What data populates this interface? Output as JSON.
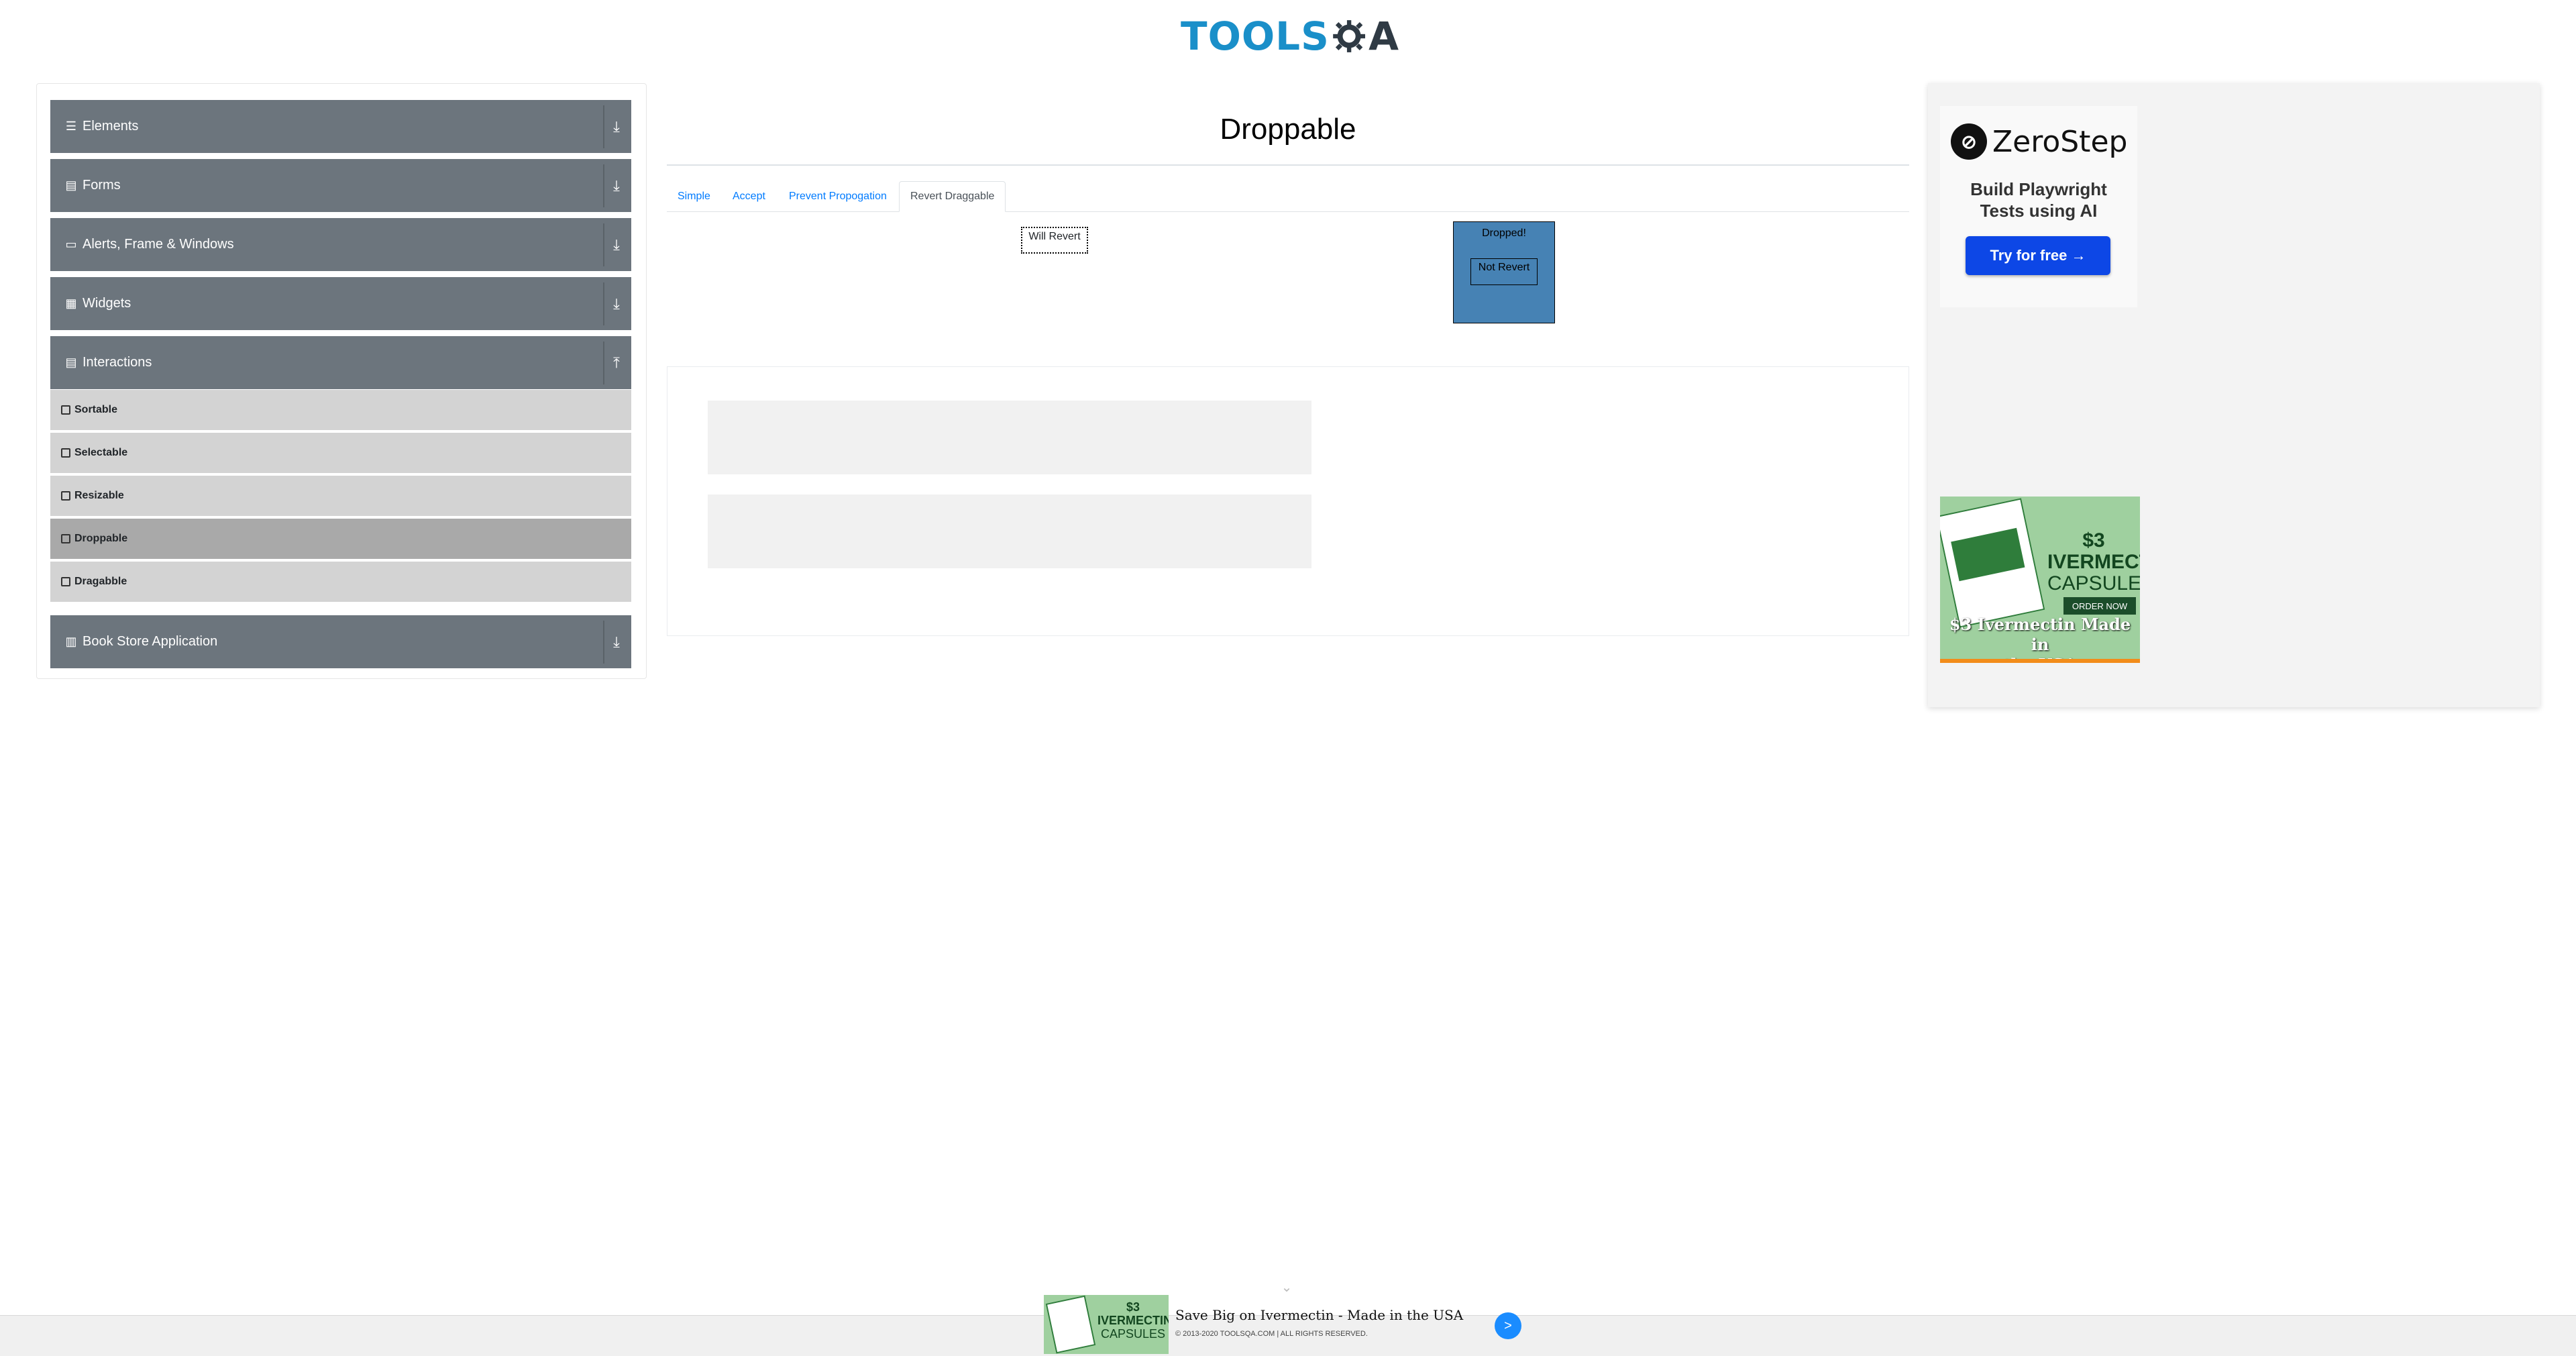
{
  "header": {
    "logo_left": "TOOLS",
    "logo_right": "A"
  },
  "sidebar": {
    "groups": [
      {
        "label": "Elements",
        "icon": "list-icon"
      },
      {
        "label": "Forms",
        "icon": "document-icon"
      },
      {
        "label": "Alerts, Frame & Windows",
        "icon": "window-icon"
      },
      {
        "label": "Widgets",
        "icon": "grid-icon"
      },
      {
        "label": "Interactions",
        "icon": "document-icon",
        "expanded": true
      },
      {
        "label": "Book Store Application",
        "icon": "book-icon"
      }
    ],
    "items": [
      {
        "label": "Sortable"
      },
      {
        "label": "Selectable"
      },
      {
        "label": "Resizable"
      },
      {
        "label": "Droppable",
        "active": true
      },
      {
        "label": "Dragabble"
      }
    ]
  },
  "main": {
    "title": "Droppable",
    "tabs": [
      {
        "label": "Simple"
      },
      {
        "label": "Accept"
      },
      {
        "label": "Prevent Propogation"
      },
      {
        "label": "Revert Draggable",
        "active": true
      }
    ],
    "drag_label": "Will Revert",
    "drop_label": "Dropped!",
    "inner_label": "Not Revert"
  },
  "right_ads": {
    "zerostep_name": "ZeroStep",
    "zerostep_tagline_1": "Build Playwright",
    "zerostep_tagline_2": "Tests using AI",
    "zerostep_button": "Try for free →",
    "iv_price_1": "$3",
    "iv_price_2": "IVERMECTIN",
    "iv_price_3": "CAPSULES",
    "iv_order": "ORDER NOW",
    "iv_caption_1": "$3 Ivermectin Made in",
    "iv_caption_2": "the USA"
  },
  "footer": {
    "ad_title": "Save Big on Ivermectin - Made in the USA",
    "ad_go": ">",
    "mini_price_1": "$3",
    "mini_price_2": "IVERMECTIN",
    "mini_price_3": "CAPSULES",
    "copyright": "© 2013-2020 TOOLSQA.COM | ALL RIGHTS RESERVED."
  },
  "colors": {
    "accent": "#007bff",
    "sidebar_header": "#6c757d",
    "sidebar_item": "#d3d3d3",
    "sidebar_active": "#a9a9a9",
    "drop_box": "#4682b4"
  }
}
